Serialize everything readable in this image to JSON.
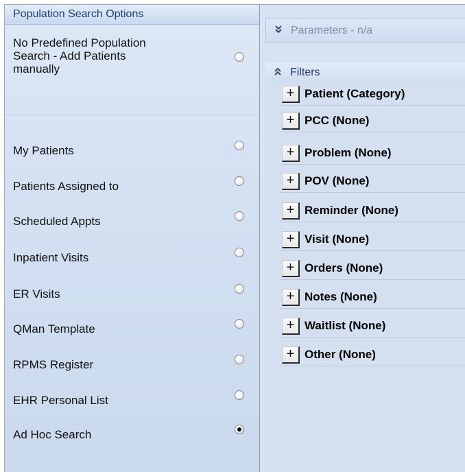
{
  "left_panel": {
    "title": "Population Search Options",
    "options": [
      {
        "label_lines": [
          "No Predefined Population",
          "Search - Add Patients",
          "manually"
        ],
        "checked": false
      },
      {
        "label": "My Patients",
        "checked": false
      },
      {
        "label": "Patients Assigned to",
        "checked": false
      },
      {
        "label": "Scheduled Appts",
        "checked": false
      },
      {
        "label": "Inpatient Visits",
        "checked": false
      },
      {
        "label": "ER Visits",
        "checked": false
      },
      {
        "label": "QMan Template",
        "checked": false
      },
      {
        "label": "RPMS Register",
        "checked": false
      },
      {
        "label": "EHR Personal List",
        "checked": false
      },
      {
        "label": "Ad Hoc Search",
        "checked": true
      }
    ]
  },
  "right_panel": {
    "parameters": {
      "title": "Parameters - n/a",
      "icon": "chevron-double-down-icon"
    },
    "filters": {
      "title": "Filters",
      "icon": "chevron-double-up-icon",
      "expand_symbol": "+",
      "items": [
        "Patient (Category)",
        "PCC (None)",
        "Problem (None)",
        "POV (None)",
        "Reminder (None)",
        "Visit (None)",
        "Orders (None)",
        "Notes (None)",
        "Waitlist (None)",
        "Other (None)"
      ]
    }
  },
  "colors": {
    "header_text": "#1f3d74",
    "panel_background": "#d4dff0",
    "disabled_text": "#7f8fa8"
  }
}
